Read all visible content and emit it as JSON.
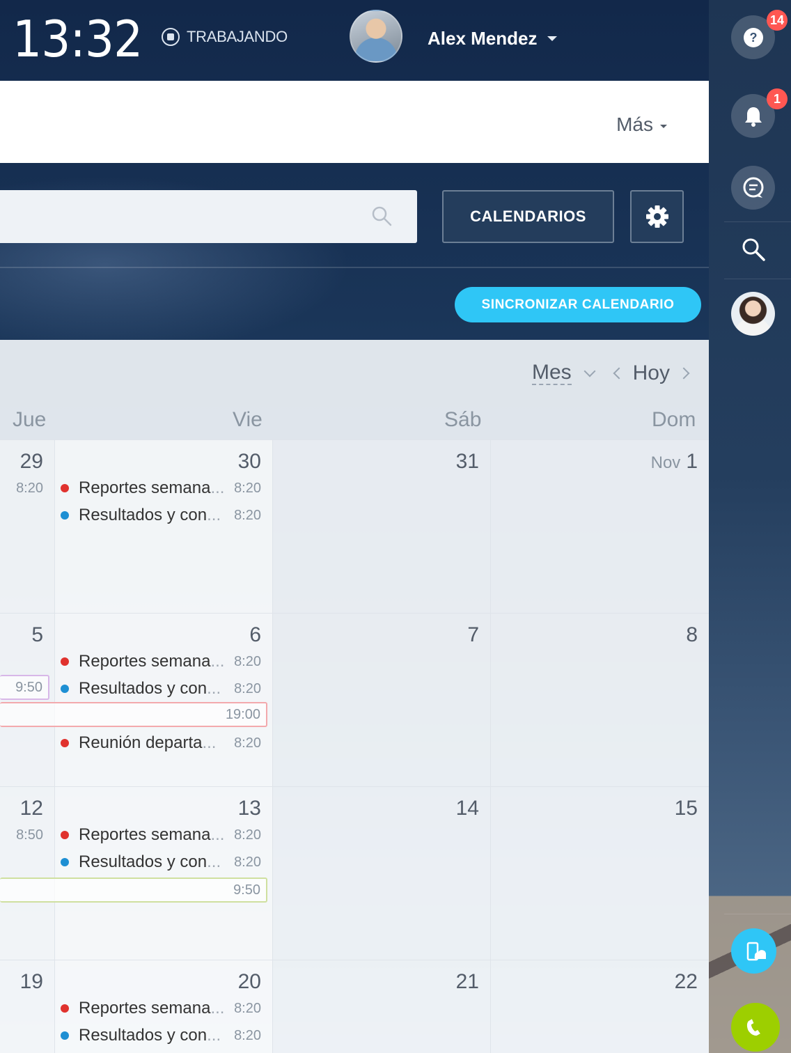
{
  "header": {
    "clock": "13:32",
    "status": "TRABAJANDO",
    "user_name": "Alex Mendez"
  },
  "menu": {
    "more_label": "Más"
  },
  "toolbar": {
    "calendars_label": "CALENDARIOS",
    "sync_label": "SINCRONIZAR CALENDARIO"
  },
  "calendar": {
    "view_label": "Mes",
    "today_label": "Hoy",
    "day_headers": [
      "Jue",
      "Vie",
      "Sáb",
      "Dom"
    ],
    "weeks": [
      {
        "days": [
          "29",
          "30",
          "31",
          "1"
        ],
        "month_label": "Nov",
        "jue_time": "8:20",
        "vie_events": [
          {
            "title": "Reportes semana",
            "time": "8:20",
            "color": "#e0322e"
          },
          {
            "title": "Resultados y con",
            "time": "8:20",
            "color": "#1e8fd3"
          }
        ]
      },
      {
        "days": [
          "5",
          "6",
          "7",
          "8"
        ],
        "jue_time": "9:50",
        "span_time": "19:00",
        "vie_events": [
          {
            "title": "Reportes semana",
            "time": "8:20",
            "color": "#e0322e"
          },
          {
            "title": "Resultados y con",
            "time": "8:20",
            "color": "#1e8fd3"
          },
          {
            "title": "Reunión departa",
            "time": "8:20",
            "color": "#e0322e"
          }
        ]
      },
      {
        "days": [
          "12",
          "13",
          "14",
          "15"
        ],
        "jue_time": "8:50",
        "span_time": "9:50",
        "vie_events": [
          {
            "title": "Reportes semana",
            "time": "8:20",
            "color": "#e0322e"
          },
          {
            "title": "Resultados y con",
            "time": "8:20",
            "color": "#1e8fd3"
          }
        ]
      },
      {
        "days": [
          "19",
          "20",
          "21",
          "22"
        ],
        "vie_events": [
          {
            "title": "Reportes semana",
            "time": "8:20",
            "color": "#e0322e"
          },
          {
            "title": "Resultados y con",
            "time": "8:20",
            "color": "#1e8fd3"
          }
        ]
      }
    ]
  },
  "sidebar": {
    "help_badge": "14",
    "notifications_badge": "1"
  },
  "colors": {
    "accent_blue": "#2fc6f6",
    "badge_red": "#ff5752",
    "phone_green": "#9dcf00",
    "dark_button": "#243d5c"
  }
}
